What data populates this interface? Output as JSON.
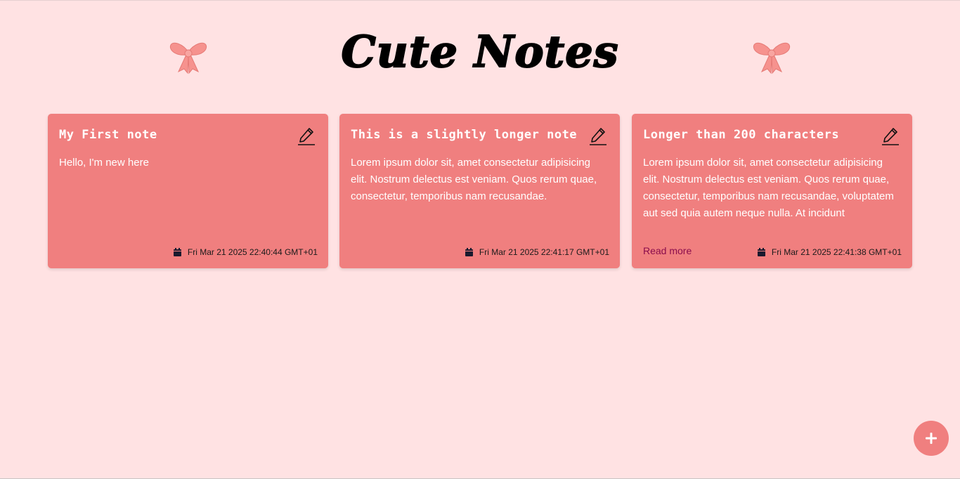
{
  "header": {
    "title": "Cute Notes",
    "bow_icon": "bow-icon",
    "bow_color": "#f6928e"
  },
  "notes": [
    {
      "title": "My First note",
      "body": "Hello, I'm new here",
      "date": "Fri Mar 21 2025 22:40:44 GMT+01",
      "read_more": null
    },
    {
      "title": "This is a slightly longer note",
      "body": "Lorem ipsum dolor sit, amet consectetur adipisicing elit. Nostrum delectus est veniam. Quos rerum quae, consectetur, temporibus nam recusandae.",
      "date": "Fri Mar 21 2025 22:41:17 GMT+01",
      "read_more": null
    },
    {
      "title": "Longer than 200 characters",
      "body": "Lorem ipsum dolor sit, amet consectetur adipisicing elit. Nostrum delectus est veniam. Quos rerum quae, consectetur, temporibus nam recusandae, voluptatem aut sed quia autem neque nulla. At incidunt",
      "date": "Fri Mar 21 2025 22:41:38 GMT+01",
      "read_more": "Read more"
    }
  ],
  "icons": {
    "edit": "pencil-icon",
    "date": "calendar-icon",
    "add": "plus-icon"
  },
  "colors": {
    "background": "#ffe2e3",
    "card": "#f07f7f",
    "read_more": "#8b0d4d",
    "fab": "#f07f7f"
  }
}
